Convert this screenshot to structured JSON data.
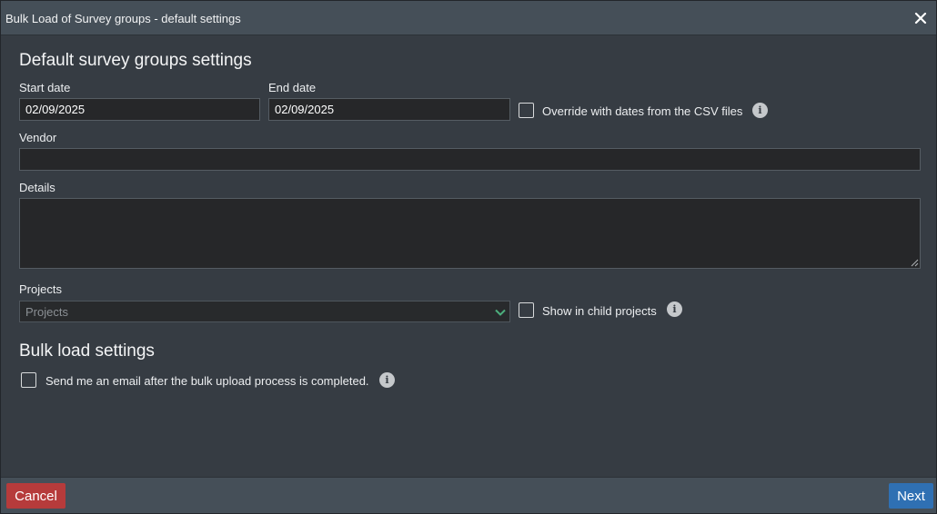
{
  "dialog": {
    "title": "Bulk Load of Survey groups - default settings",
    "close_icon": "close-icon"
  },
  "default_settings": {
    "heading": "Default survey groups settings",
    "start_date": {
      "label": "Start date",
      "value": "02/09/2025"
    },
    "end_date": {
      "label": "End date",
      "value": "02/09/2025"
    },
    "override_dates": {
      "label": "Override with dates from the CSV files",
      "checked": false,
      "icon": "info-icon"
    },
    "vendor": {
      "label": "Vendor",
      "value": ""
    },
    "details": {
      "label": "Details",
      "value": ""
    },
    "projects": {
      "label": "Projects",
      "placeholder": "Projects",
      "icon": "chevron-down-icon",
      "chevron_color": "#4caf7d"
    },
    "show_child_projects": {
      "label": "Show in child projects",
      "checked": false,
      "icon": "info-icon"
    }
  },
  "bulk_settings": {
    "heading": "Bulk load settings",
    "send_email": {
      "label": "Send me an email after the bulk upload process is completed.",
      "checked": false,
      "icon": "info-icon"
    }
  },
  "footer": {
    "cancel_label": "Cancel",
    "next_label": "Next",
    "cancel_color": "#b63b3b",
    "next_color": "#2f70b3"
  }
}
